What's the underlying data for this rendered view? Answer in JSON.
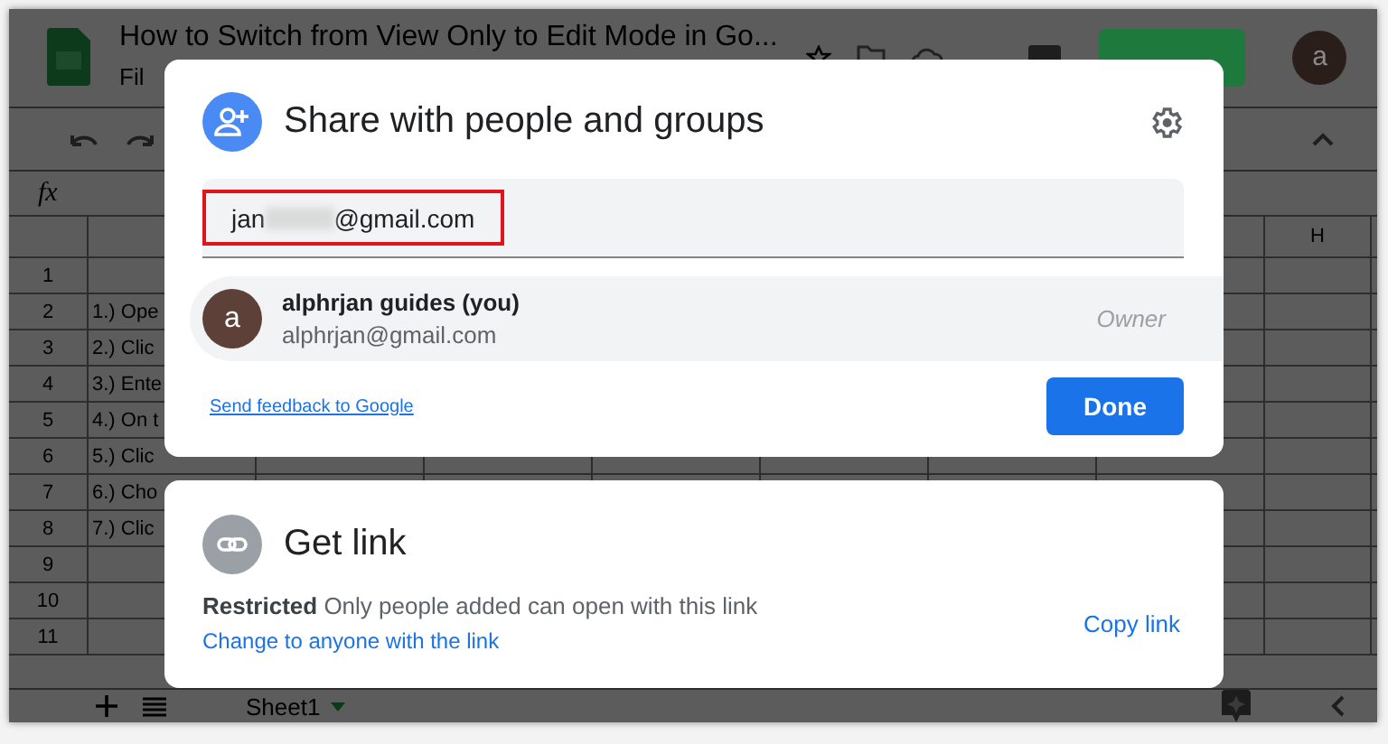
{
  "sheet": {
    "title": "How to Switch from View Only to Edit Mode in Go...",
    "menu": [
      "Fil"
    ],
    "avatar": "a",
    "column_headers": [
      {
        "label": "H"
      }
    ],
    "rows": [
      {
        "number": "1"
      },
      {
        "number": "2",
        "text": "1.) Ope"
      },
      {
        "number": "3",
        "text": "2.) Clic"
      },
      {
        "number": "4",
        "text": "3.) Ente"
      },
      {
        "number": "5",
        "text": "4.) On t"
      },
      {
        "number": "6",
        "text": "5.) Clic"
      },
      {
        "number": "7",
        "text": "6.) Cho"
      },
      {
        "number": "8",
        "text": "7.) Clic"
      },
      {
        "number": "9"
      },
      {
        "number": "10"
      },
      {
        "number": "11"
      }
    ],
    "sheet_tab": "Sheet1",
    "formula_label": "fx"
  },
  "share_dialog": {
    "title": "Share with people and groups",
    "field": {
      "value_start": "jan",
      "value_end": "@gmail.com",
      "highlighted": true
    },
    "people": [
      {
        "avatar": "a",
        "name": "alphrjan guides (you)",
        "email": "alphrjan@gmail.com",
        "role": "Owner"
      }
    ],
    "feedback_link": "Send feedback to Google",
    "done_button": "Done"
  },
  "link_card": {
    "title": "Get link",
    "access": "**Restricted** Only people added can open with this link",
    "change_link": "Change to anyone with the link",
    "copy_button": "Copy link"
  }
}
